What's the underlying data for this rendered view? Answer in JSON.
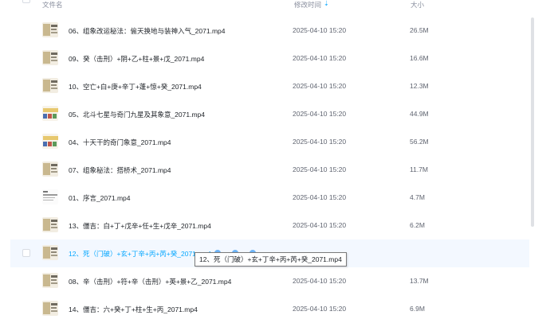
{
  "header": {
    "name_label": "文件名",
    "time_label": "修改时间",
    "sort_indicator": "⇣",
    "size_label": "大小"
  },
  "files": [
    {
      "name": "06、组象改运秘法：偷天换地与装神入气_2071.mp4",
      "time": "2025-04-10 15:20",
      "size": "26.5M"
    },
    {
      "name": "09、癸（击刑）+阴+乙+柱+景+戊_2071.mp4",
      "time": "2025-04-10 15:20",
      "size": "16.6M"
    },
    {
      "name": "10、空亡+白+庚+辛丁+蓬+惊+癸_2071.mp4",
      "time": "2025-04-10 15:20",
      "size": "12.3M"
    },
    {
      "name": "05、北斗七星与奇门九星及其象意_2071.mp4",
      "time": "2025-04-10 15:20",
      "size": "44.9M"
    },
    {
      "name": "04、十天干的奇门象意_2071.mp4",
      "time": "2025-04-10 15:20",
      "size": "56.2M"
    },
    {
      "name": "07、组象秘法：搭桥术_2071.mp4",
      "time": "2025-04-10 15:20",
      "size": "11.7M"
    },
    {
      "name": "01、序言_2071.mp4",
      "time": "2025-04-10 15:20",
      "size": "4.7M"
    },
    {
      "name": "13、僵吉：白+丁+戊辛+任+生+戊辛_2071.mp4",
      "time": "2025-04-10 15:20",
      "size": "6.2M"
    },
    {
      "name": "12、死（门破）+玄+丁辛+丙+芮+癸_2071.mp4",
      "time": "",
      "size": ""
    },
    {
      "name": "08、辛（击刑）+符+辛（击刑）+英+景+乙_2071.mp4",
      "time": "2025-04-10 15:20",
      "size": "13.7M"
    },
    {
      "name": "14、僵吉：六+癸+丁+柱+生+丙_2071.mp4",
      "time": "2025-04-10 15:20",
      "size": "6.9M"
    }
  ],
  "tooltip": "12、死（门破）+玄+丁辛+丙+芮+癸_2071.mp4",
  "colors": {
    "accent": "#06a7ff",
    "hover_row": "#f3f8ff",
    "header_text": "#878c9c"
  }
}
